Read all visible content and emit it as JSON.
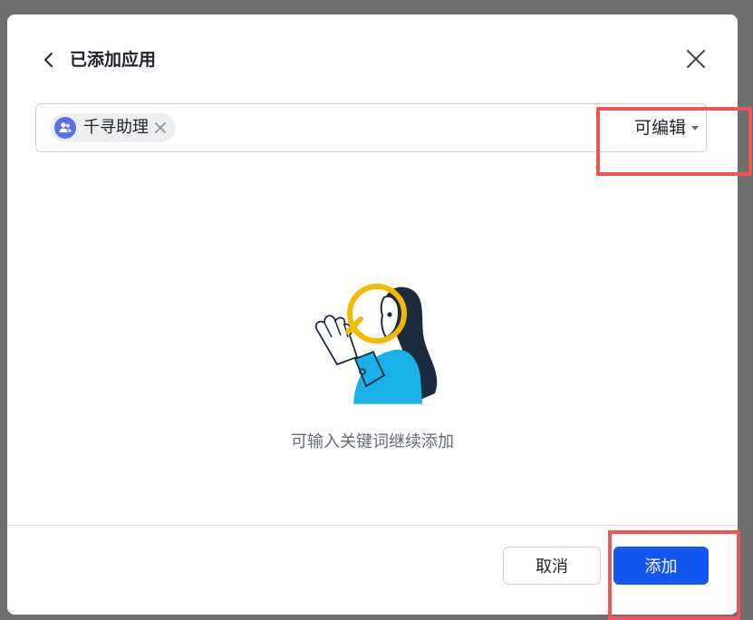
{
  "dialog": {
    "title": "已添加应用",
    "back_icon": "chevron-left-icon",
    "close_icon": "close-icon"
  },
  "selector": {
    "tag": {
      "label": "千寻助理",
      "avatar_icon": "group-users-icon",
      "avatar_color": "#5b6fe8",
      "remove_icon": "close-small-icon"
    },
    "permission": {
      "label": "可编辑",
      "caret_icon": "caret-down-icon"
    }
  },
  "empty_state": {
    "illustration": "magnifier-person-illustration",
    "text": "可输入关键词继续添加"
  },
  "footer": {
    "cancel_label": "取消",
    "add_label": "添加"
  },
  "colors": {
    "primary": "#1456f0",
    "highlight": "#ef5555",
    "overlay": "#6e6e6e"
  }
}
